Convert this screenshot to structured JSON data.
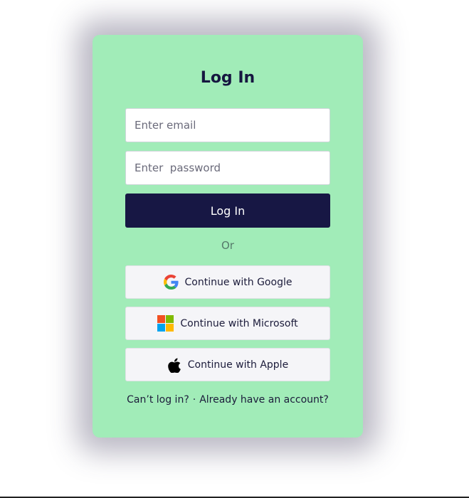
{
  "login": {
    "title": "Log In",
    "email_placeholder": "Enter email",
    "password_placeholder": "Enter  password",
    "submit_label": "Log In",
    "divider_text": "Or"
  },
  "social": {
    "google": {
      "label": "Continue with Google",
      "icon": "google-icon"
    },
    "microsoft": {
      "label": "Continue with Microsoft",
      "icon": "microsoft-icon"
    },
    "apple": {
      "label": "Continue with Apple",
      "icon": "apple-icon"
    }
  },
  "footer": {
    "cant_login": "Can’t log in?",
    "separator": "·",
    "have_account": "Already have an account?"
  },
  "colors": {
    "card_background": "#a1ecb8",
    "primary_button": "#171744",
    "social_button": "#f5f5f8"
  }
}
